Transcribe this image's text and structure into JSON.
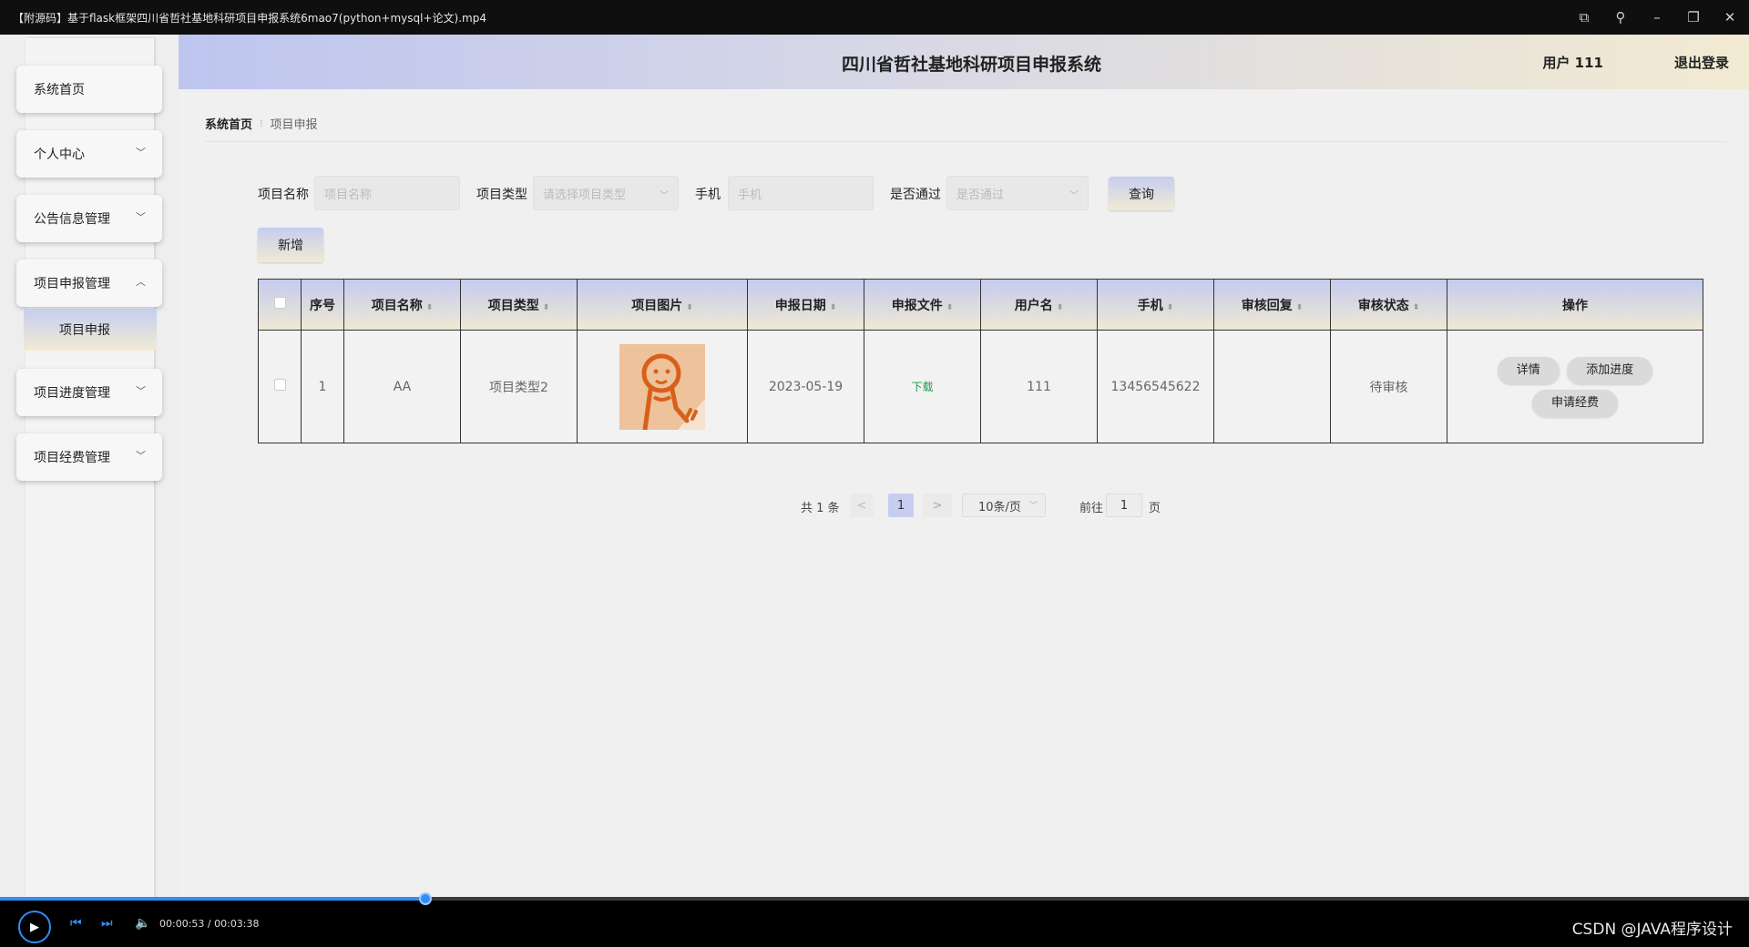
{
  "player": {
    "window_title": "【附源码】基于flask框架四川省哲社基地科研项目申报系统6mao7(python+mysql+论文).mp4",
    "current_time": "00:00:53",
    "total_time": "00:03:38",
    "time_sep": " / ",
    "progress": 0.243,
    "watermark": "CSDN @JAVA程序设计",
    "accent_color": "#2f8df5",
    "icons": [
      "picture-in-picture-icon",
      "pin-icon",
      "minimize-icon",
      "maximize-icon",
      "close-icon",
      "play-icon",
      "previous-icon",
      "next-icon",
      "volume-icon"
    ]
  },
  "header": {
    "title": "四川省哲社基地科研项目申报系统",
    "user": "用户 111",
    "logout": "退出登录"
  },
  "sidebar": {
    "items": [
      {
        "label": "系统首页",
        "has_arrow": false
      },
      {
        "label": "个人中心",
        "has_arrow": true
      },
      {
        "label": "公告信息管理",
        "has_arrow": true
      },
      {
        "label": "项目申报管理",
        "has_arrow": true,
        "expanded": true
      },
      {
        "label": "项目进度管理",
        "has_arrow": true
      },
      {
        "label": "项目经费管理",
        "has_arrow": true
      }
    ],
    "active_sub": "项目申报"
  },
  "breadcrumb": {
    "home": "系统首页",
    "current": "项目申报"
  },
  "search": {
    "name_label": "项目名称",
    "name_placeholder": "项目名称",
    "type_label": "项目类型",
    "type_placeholder": "请选择项目类型",
    "phone_label": "手机",
    "phone_placeholder": "手机",
    "passed_label": "是否通过",
    "passed_placeholder": "是否通过",
    "query_button": "查询",
    "add_button": "新增"
  },
  "table": {
    "columns": [
      "序号",
      "项目名称",
      "项目类型",
      "项目图片",
      "申报日期",
      "申报文件",
      "用户名",
      "手机",
      "审核回复",
      "审核状态",
      "操作"
    ],
    "rows": [
      {
        "index": "1",
        "name": "AA",
        "type": "项目类型2",
        "date": "2023-05-19",
        "file": "下载",
        "username": "111",
        "phone": "13456545622",
        "reply": "",
        "status": "待审核",
        "actions": [
          "详情",
          "添加进度",
          "申请经费"
        ]
      }
    ]
  },
  "pagination": {
    "total": "共 1 条",
    "prev": "<",
    "page": "1",
    "next": ">",
    "size": "10条/页",
    "goto_label": "前往",
    "goto_value": "1",
    "page_unit": "页"
  }
}
